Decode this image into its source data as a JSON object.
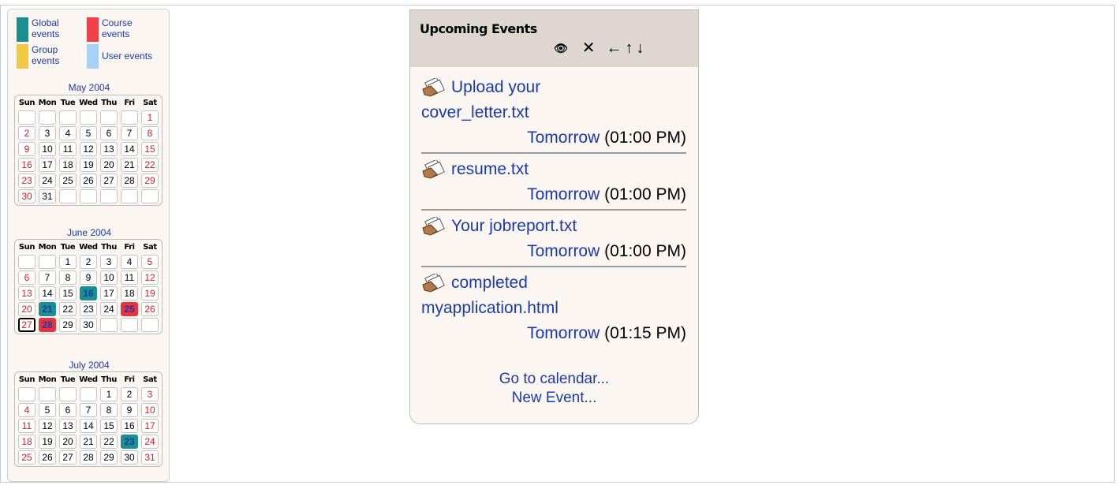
{
  "legend": {
    "global": "Global events",
    "course": "Course events",
    "group": "Group events",
    "user": "User events",
    "colors": {
      "global": "#1a8f8f",
      "course": "#f0404a",
      "group": "#f5c842",
      "user": "#a9d0f5"
    }
  },
  "weekdays": [
    "Sun",
    "Mon",
    "Tue",
    "Wed",
    "Thu",
    "Fri",
    "Sat"
  ],
  "months": [
    {
      "title": "May 2004",
      "weeks": [
        [
          "",
          "",
          "",
          "",
          "",
          "",
          "1"
        ],
        [
          "2",
          "3",
          "4",
          "5",
          "6",
          "7",
          "8"
        ],
        [
          "9",
          "10",
          "11",
          "12",
          "13",
          "14",
          "15"
        ],
        [
          "16",
          "17",
          "18",
          "19",
          "20",
          "21",
          "22"
        ],
        [
          "23",
          "24",
          "25",
          "26",
          "27",
          "28",
          "29"
        ],
        [
          "30",
          "31",
          "",
          "",
          "",
          "",
          ""
        ]
      ],
      "highlights": {}
    },
    {
      "title": "June 2004",
      "weeks": [
        [
          "",
          "",
          "1",
          "2",
          "3",
          "4",
          "5"
        ],
        [
          "6",
          "7",
          "8",
          "9",
          "10",
          "11",
          "12"
        ],
        [
          "13",
          "14",
          "15",
          "16",
          "17",
          "18",
          "19"
        ],
        [
          "20",
          "21",
          "22",
          "23",
          "24",
          "25",
          "26"
        ],
        [
          "27",
          "28",
          "29",
          "30",
          "",
          "",
          ""
        ]
      ],
      "highlights": {
        "16": "teal",
        "21": "teal",
        "25": "red",
        "28": "red"
      },
      "today": "27"
    },
    {
      "title": "July 2004",
      "weeks": [
        [
          "",
          "",
          "",
          "",
          "1",
          "2",
          "3"
        ],
        [
          "4",
          "5",
          "6",
          "7",
          "8",
          "9",
          "10"
        ],
        [
          "11",
          "12",
          "13",
          "14",
          "15",
          "16",
          "17"
        ],
        [
          "18",
          "19",
          "20",
          "21",
          "22",
          "23",
          "24"
        ],
        [
          "25",
          "26",
          "27",
          "28",
          "29",
          "30",
          "31"
        ]
      ],
      "highlights": {
        "23": "teal"
      }
    }
  ],
  "upcoming": {
    "title": "Upcoming Events",
    "controls": [
      "eye-icon",
      "close-icon",
      "arrow-left-icon",
      "arrow-up-icon",
      "arrow-down-icon"
    ],
    "events": [
      {
        "name_line1": "Upload your",
        "name_line2": "cover_letter.txt",
        "day": "Tomorrow",
        "time": "(01:00 PM)"
      },
      {
        "name_line1": "resume.txt",
        "name_line2": "",
        "day": "Tomorrow",
        "time": "(01:00 PM)"
      },
      {
        "name_line1": "Your jobreport.txt",
        "name_line2": "",
        "day": "Tomorrow",
        "time": "(01:00 PM)"
      },
      {
        "name_line1": "completed",
        "name_line2": "myapplication.html",
        "day": "Tomorrow",
        "time": "(01:15 PM)"
      }
    ],
    "go_to_calendar": "Go to calendar...",
    "new_event": "New Event..."
  }
}
